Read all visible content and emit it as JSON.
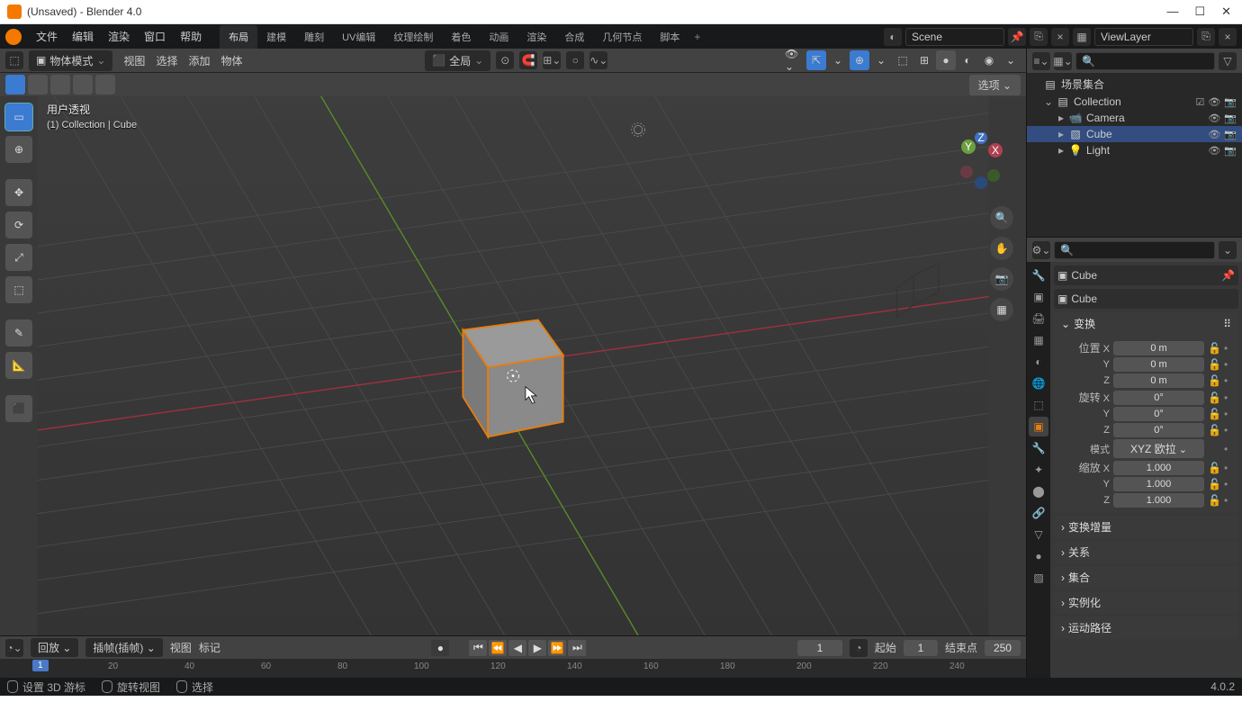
{
  "window": {
    "title": "(Unsaved) - Blender 4.0"
  },
  "menu": {
    "items": [
      "文件",
      "编辑",
      "渲染",
      "窗口",
      "帮助"
    ]
  },
  "workspaces": {
    "tabs": [
      "布局",
      "建模",
      "雕刻",
      "UV编辑",
      "纹理绘制",
      "着色",
      "动画",
      "渲染",
      "合成",
      "几何节点",
      "脚本"
    ],
    "active": 0
  },
  "scene": {
    "label": "Scene",
    "layer": "ViewLayer"
  },
  "vpheader": {
    "mode": "物体模式",
    "menus": [
      "视图",
      "选择",
      "添加",
      "物体"
    ],
    "global": "全局",
    "options": "选项"
  },
  "overlay": {
    "l1": "用户透视",
    "l2": "(1) Collection | Cube"
  },
  "outliner": {
    "root": "场景集合",
    "coll": "Collection",
    "items": [
      {
        "name": "Camera",
        "icon": "📹"
      },
      {
        "name": "Cube",
        "icon": "▧"
      },
      {
        "name": "Light",
        "icon": "💡"
      }
    ],
    "sel": 1,
    "search": ""
  },
  "props": {
    "search": "",
    "obj": "Cube",
    "panels": {
      "transform": "变换",
      "delta": "变换增量",
      "rel": "关系",
      "coll": "集合",
      "inst": "实例化",
      "motion": "运动路径"
    },
    "loc": {
      "label": "位置",
      "x": "0 m",
      "y": "0 m",
      "z": "0 m"
    },
    "rot": {
      "label": "旋转",
      "x": "0°",
      "y": "0°",
      "z": "0°"
    },
    "mode": {
      "label": "模式",
      "val": "XYZ 欧拉"
    },
    "scale": {
      "label": "缩放",
      "x": "1.000",
      "y": "1.000",
      "z": "1.000"
    }
  },
  "timeline": {
    "playback": "回放",
    "keying": "插帧(插帧)",
    "menus": [
      "视图",
      "标记"
    ],
    "cur": "1",
    "start_l": "起始",
    "start": "1",
    "end_l": "结束点",
    "end": "250",
    "ticks": [
      {
        "v": "20",
        "p": 120
      },
      {
        "v": "40",
        "p": 205
      },
      {
        "v": "60",
        "p": 290
      },
      {
        "v": "80",
        "p": 375
      },
      {
        "v": "100",
        "p": 460
      },
      {
        "v": "120",
        "p": 545
      },
      {
        "v": "140",
        "p": 630
      },
      {
        "v": "160",
        "p": 715
      },
      {
        "v": "180",
        "p": 800
      },
      {
        "v": "200",
        "p": 885
      },
      {
        "v": "220",
        "p": 970
      },
      {
        "v": "240",
        "p": 1055
      }
    ]
  },
  "status": {
    "a": "设置 3D 游标",
    "b": "旋转视图",
    "c": "选择",
    "ver": "4.0.2"
  }
}
